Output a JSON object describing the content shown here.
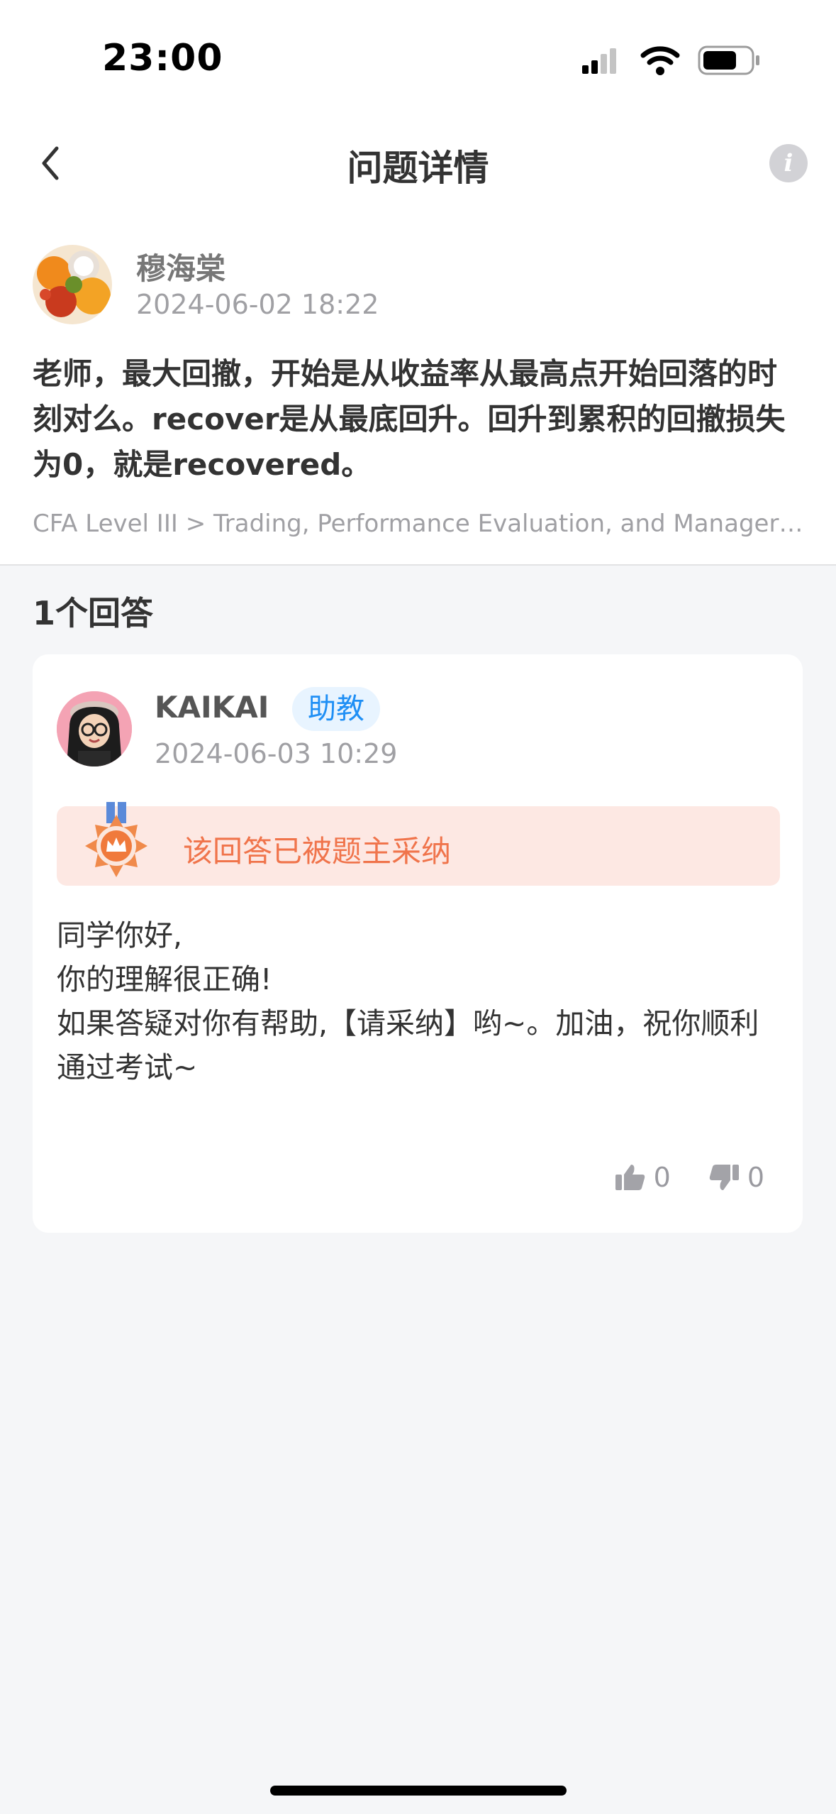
{
  "status_bar": {
    "time": "23:00"
  },
  "nav": {
    "title": "问题详情",
    "back_icon": "chevron-left-icon",
    "info_icon": "info-icon"
  },
  "question": {
    "author": "穆海棠",
    "time": "2024-06-02 18:22",
    "text": "老师，最大回撤，开始是从收益率从最高点开始回落的时刻对么。recover是从最底回升。回升到累积的回撤损失为0，就是recovered。",
    "breadcrumb": "CFA Level III > Trading, Performance Evaluation, and Manager Selection"
  },
  "answers": {
    "count_label": "1个回答",
    "items": [
      {
        "author": "KAIKAI",
        "badge": "助教",
        "time": "2024-06-03 10:29",
        "accepted_label": "该回答已被题主采纳",
        "body_lines": [
          "同学你好,",
          "你的理解很正确!",
          "",
          "如果答疑对你有帮助,【请采纳】哟~。加油，祝你顺利通过考试~"
        ],
        "likes": "0",
        "dislikes": "0"
      }
    ]
  },
  "colors": {
    "accent_blue": "#1f8ff5",
    "accepted_orange": "#f0744b",
    "accepted_bg": "#fde8e3"
  }
}
